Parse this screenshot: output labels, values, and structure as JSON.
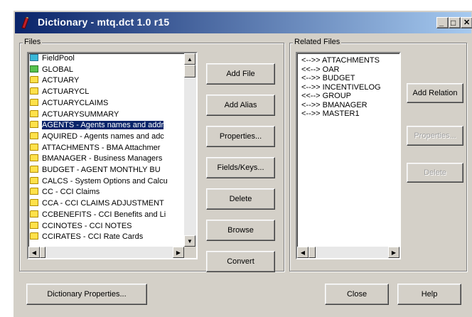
{
  "window": {
    "title": "Dictionary - mtq.dct 1.0 r15",
    "minimize_glyph": "_",
    "maximize_glyph": "□",
    "close_glyph": "✕"
  },
  "files": {
    "label": "Files",
    "items": [
      {
        "text": "FieldPool",
        "icon": "teal-table-icon",
        "selected": false
      },
      {
        "text": "GLOBAL",
        "icon": "green-table-icon",
        "selected": false
      },
      {
        "text": "ACTUARY",
        "icon": "folder-icon",
        "selected": false
      },
      {
        "text": "ACTUARYCL",
        "icon": "folder-icon",
        "selected": false
      },
      {
        "text": "ACTUARYCLAIMS",
        "icon": "folder-icon",
        "selected": false
      },
      {
        "text": "ACTUARYSUMMARY",
        "icon": "folder-icon",
        "selected": false
      },
      {
        "text": "AGENTS - Agents names and addr",
        "icon": "folder-icon",
        "selected": true
      },
      {
        "text": "AQUIRED - Agents names and adc",
        "icon": "folder-icon",
        "selected": false
      },
      {
        "text": "ATTACHMENTS - BMA Attachmer",
        "icon": "folder-icon",
        "selected": false
      },
      {
        "text": "BMANAGER - Business Managers",
        "icon": "folder-icon",
        "selected": false
      },
      {
        "text": "BUDGET - AGENT MONTHLY BU",
        "icon": "folder-icon",
        "selected": false
      },
      {
        "text": "CALCS - System Options and Calcu",
        "icon": "folder-icon",
        "selected": false
      },
      {
        "text": "CC - CCI Claims",
        "icon": "folder-icon",
        "selected": false
      },
      {
        "text": "CCA - CCI CLAIMS ADJUSTMENT",
        "icon": "folder-icon",
        "selected": false
      },
      {
        "text": "CCBENEFITS - CCI Benefits and Li",
        "icon": "folder-icon",
        "selected": false
      },
      {
        "text": "CCINOTES - CCI NOTES",
        "icon": "folder-icon",
        "selected": false
      },
      {
        "text": "CCIRATES - CCI Rate Cards",
        "icon": "folder-icon",
        "selected": false
      }
    ],
    "scroll_up": "▲",
    "scroll_down": "▼",
    "scroll_left": "◀",
    "scroll_right": "▶"
  },
  "file_buttons": {
    "add_file": "Add File",
    "add_alias": "Add Alias",
    "properties": "Properties...",
    "fields_keys": "Fields/Keys...",
    "delete": "Delete",
    "browse": "Browse",
    "convert": "Convert"
  },
  "related": {
    "label": "Related Files",
    "items": [
      "<-->> ATTACHMENTS",
      "<<--> OAR",
      "<-->> BUDGET",
      "<-->> INCENTIVELOG",
      "<<--> GROUP",
      "<-->> BMANAGER",
      "<-->> MASTER1"
    ],
    "scroll_left": "◀",
    "scroll_right": "▶"
  },
  "related_buttons": {
    "add_relation": "Add Relation",
    "properties": "Properties...",
    "delete": "Delete"
  },
  "bottom_buttons": {
    "dictionary_properties": "Dictionary Properties...",
    "close": "Close",
    "help": "Help"
  },
  "colors": {
    "title_gradient_start": "#0a246a",
    "title_gradient_end": "#a6caf0",
    "face": "#d4d0c8",
    "selection": "#0a246a"
  }
}
